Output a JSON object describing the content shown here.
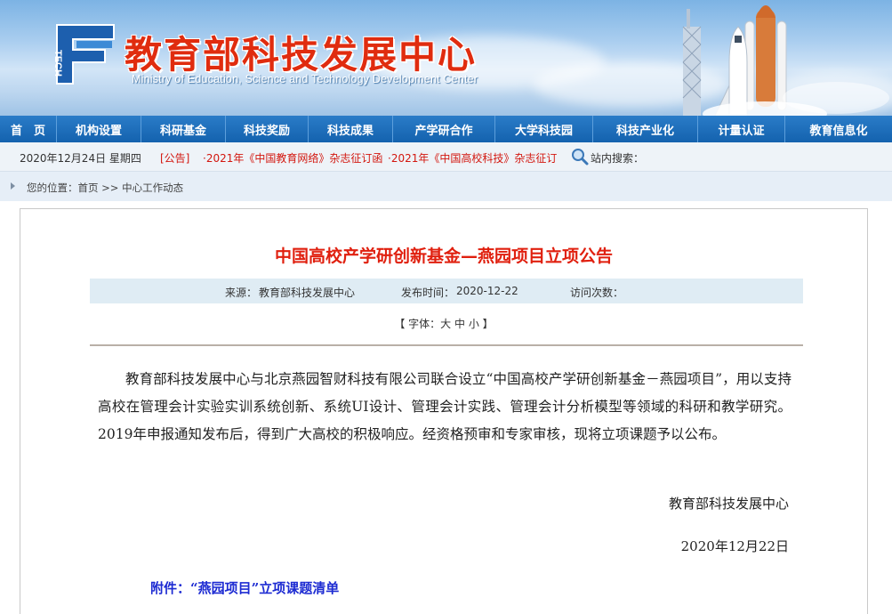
{
  "header": {
    "title": "教育部科技发展中心",
    "subtitle": "Ministry of Education, Science and Technology Development Center",
    "logo_icon": "tech-logo-icon",
    "logo_text": "TECH"
  },
  "nav": {
    "items": [
      {
        "label": "首　页"
      },
      {
        "label": "机构设置"
      },
      {
        "label": "科研基金"
      },
      {
        "label": "科技奖励"
      },
      {
        "label": "科技成果"
      },
      {
        "label": "产学研合作"
      },
      {
        "label": "大学科技园"
      },
      {
        "label": "科技产业化"
      },
      {
        "label": "计量认证"
      },
      {
        "label": "教育信息化"
      }
    ]
  },
  "infobar": {
    "date": "2020年12月24日 星期四",
    "notice_label": "[公告]",
    "notices": [
      "·2021年《中国教育网络》杂志征订函",
      "·2021年《中国高校科技》杂志征订"
    ],
    "search_label": "站内搜索："
  },
  "breadcrumb": {
    "text": "您的位置：首页 >> 中心工作动态"
  },
  "article": {
    "title": "中国高校产学研创新基金—燕园项目立项公告",
    "source_label": "来源：",
    "source_value": "教育部科技发展中心",
    "publish_label": "发布时间：",
    "publish_value": "2020-12-22",
    "visits_label": "访问次数：",
    "font_prefix": "【 字体：",
    "font_large": "大",
    "font_medium": "中",
    "font_small": "小",
    "font_suffix": " 】",
    "body": "教育部科技发展中心与北京燕园智财科技有限公司联合设立“中国高校产学研创新基金－燕园项目”，用以支持高校在管理会计实验实训系统创新、系统UI设计、管理会计实践、管理会计分析模型等领域的科研和教学研究。2019年申报通知发布后，得到广大高校的积极响应。经资格预审和专家审核，现将立项课题予以公布。",
    "signature": "教育部科技发展中心",
    "sign_date": "2020年12月22日",
    "attachment": "附件：“燕园项目”立项课题清单"
  },
  "colors": {
    "nav_bg": "#1a6bb8",
    "title_red": "#e0200f",
    "attachment_blue": "#1d2bd2"
  }
}
